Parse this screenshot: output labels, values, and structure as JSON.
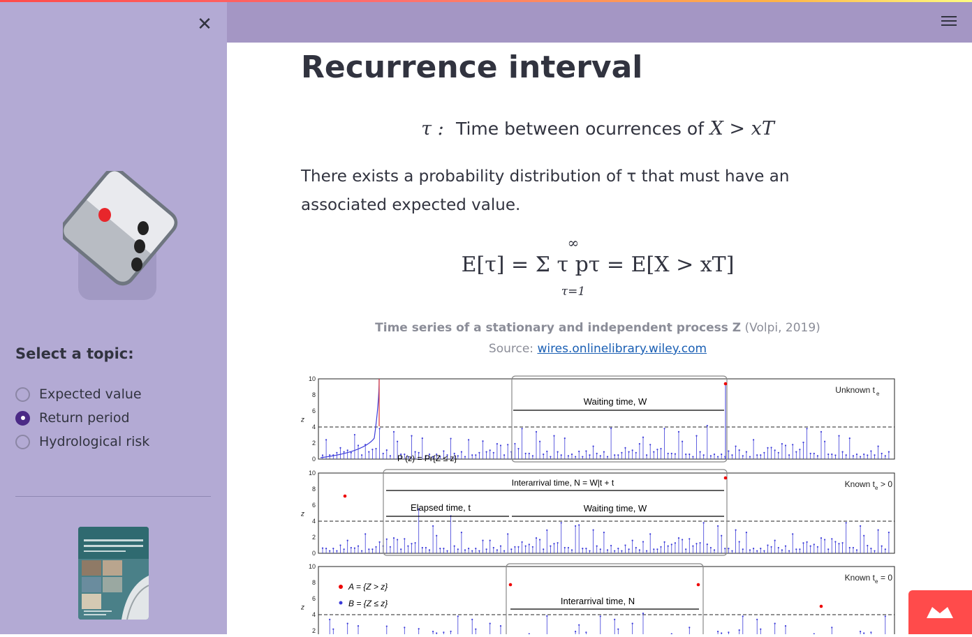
{
  "sidebar": {
    "close_symbol": "✕",
    "topic_heading": "Select a topic:",
    "topics": [
      {
        "label": "Expected value",
        "selected": false
      },
      {
        "label": "Return period",
        "selected": true
      },
      {
        "label": "Hydrological risk",
        "selected": false
      }
    ],
    "book_icon": "book-cover-icon"
  },
  "main": {
    "title": "Recurrence interval",
    "eq1_symbol": "τ :",
    "eq1_text": "Time between ocurrences of",
    "eq1_rhs": "X > xT",
    "paragraph": "There exists a probability distribution of τ that must have an associated expected value.",
    "eq2": "E[τ] = Σ τ pτ = E[X > xT]",
    "eq2_upper": "∞",
    "eq2_lower": "τ=1",
    "caption_bold": "Time series of a stationary and independent process Z",
    "caption_cite": "(Volpi, 2019)",
    "source_label": "Source:",
    "source_link": "wires.onlinelibrary.wiley.com"
  },
  "figure": {
    "panels": [
      {
        "label": "Unknown t",
        "sub": "e"
      },
      {
        "label": "Known t",
        "sub": "e",
        "suffix": " > 0"
      },
      {
        "label": "Known t",
        "sub": "e",
        "suffix": " = 0"
      }
    ],
    "waiting_time": "Waiting time, W",
    "interarrival_full": "Interarrival time, N = W|t + t",
    "elapsed_time": "Elapsed time, t",
    "interarrival_time": "Interarrival time, N",
    "cdf_label": "P (z) = Pr{Z ≤ z}",
    "legend_a": "A = {Z > z}",
    "legend_b": "B = {Z ≤ z}",
    "z_label": "z",
    "y_ticks": [
      "10",
      "8",
      "6",
      "4",
      "2",
      "0"
    ]
  },
  "colors": {
    "accent": "#4b2a86",
    "sidebar": "#b3aad4",
    "header": "#a496c4",
    "deploy": "#ff4b4b"
  }
}
